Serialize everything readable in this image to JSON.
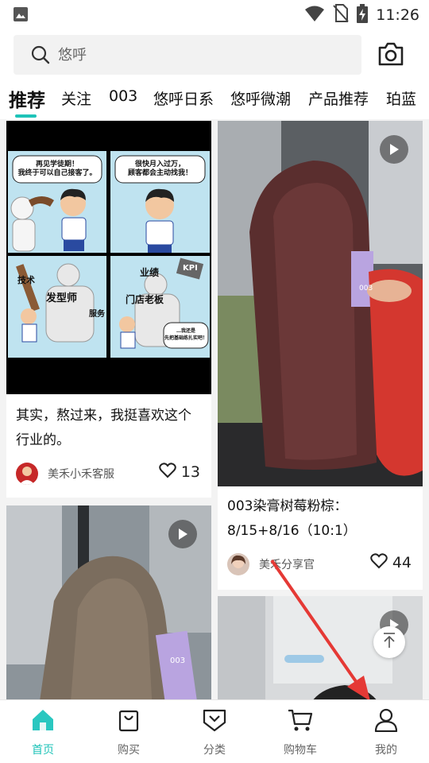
{
  "status_bar": {
    "time": "11:26",
    "icons": [
      "image-icon",
      "wifi-icon",
      "no-sim-icon",
      "battery-charging-icon"
    ]
  },
  "search": {
    "placeholder": "悠呼"
  },
  "tabs": [
    {
      "label": "推荐",
      "active": true
    },
    {
      "label": "关注"
    },
    {
      "label": "003"
    },
    {
      "label": "悠呼日系"
    },
    {
      "label": "悠呼微潮"
    },
    {
      "label": "产品推荐"
    },
    {
      "label": "珀蓝"
    }
  ],
  "cards": [
    {
      "title_lines": [
        "其实，熬过来，我挺喜欢这个",
        "行业的。"
      ],
      "author": "美禾小禾客服",
      "likes": "13",
      "comic": {
        "p1": [
          "再见学徒期！",
          "我终于可以自己接客了。"
        ],
        "p2": [
          "很快月入过万，",
          "顾客都会主动找我！"
        ],
        "p3_big": "发型师",
        "p3_stick": "技术",
        "p3_side": "服务",
        "p4_top": "业绩",
        "p4_sign": "KPI",
        "p4_big": "门店老板",
        "p4_bubble": [
          "…我还是",
          "先把基础练扎实吧！"
        ]
      }
    },
    {
      "title_lines": [
        "003染膏树莓粉棕：",
        "8/15+8/16（10:1）"
      ],
      "author": "美禾分享官",
      "likes": "44",
      "box_label": "003"
    },
    {
      "box_label": "003"
    },
    {}
  ],
  "bottom_nav": [
    {
      "label": "首页",
      "icon": "home-icon",
      "active": true
    },
    {
      "label": "购买",
      "icon": "shopping-bag-icon"
    },
    {
      "label": "分类",
      "icon": "category-icon"
    },
    {
      "label": "购物车",
      "icon": "cart-icon"
    },
    {
      "label": "我的",
      "icon": "profile-icon"
    }
  ],
  "colors": {
    "accent": "#1ec3b8",
    "annotation_arrow": "#e53935"
  }
}
